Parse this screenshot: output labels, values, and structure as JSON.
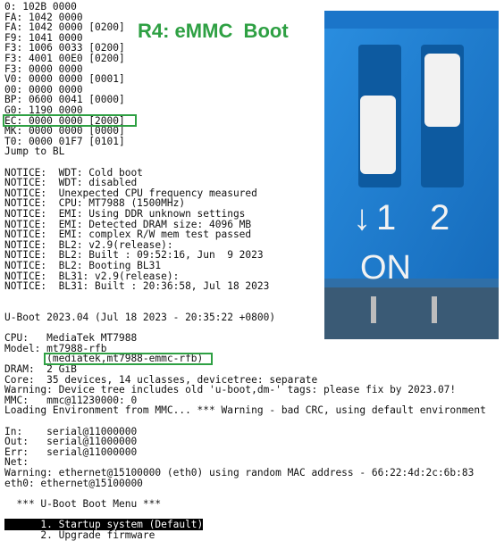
{
  "overlay": {
    "title": "R4: eMMC  Boot"
  },
  "dip_switch": {
    "on_label": "ON",
    "switch_1_label": "1",
    "switch_2_label": "2",
    "arrow_glyph": "↓"
  },
  "terminal": {
    "lines": [
      "0: 102B 0000",
      "FA: 1042 0000",
      "FA: 1042 0000 [0200]",
      "F9: 1041 0000",
      "F3: 1006 0033 [0200]",
      "F3: 4001 00E0 [0200]",
      "F3: 0000 0000",
      "V0: 0000 0000 [0001]",
      "00: 0000 0000",
      "BP: 0600 0041 [0000]",
      "G0: 1190 0000",
      "EC: 0000 0000 [2000]",
      "MK: 0000 0000 [0000]",
      "T0: 0000 01F7 [0101]",
      "Jump to BL",
      "",
      "NOTICE:  WDT: Cold boot",
      "NOTICE:  WDT: disabled",
      "NOTICE:  Unexpected CPU frequency measured",
      "NOTICE:  CPU: MT7988 (1500MHz)",
      "NOTICE:  EMI: Using DDR unknown settings",
      "NOTICE:  EMI: Detected DRAM size: 4096 MB",
      "NOTICE:  EMI: complex R/W mem test passed",
      "NOTICE:  BL2: v2.9(release):",
      "NOTICE:  BL2: Built : 09:52:16, Jun  9 2023",
      "NOTICE:  BL2: Booting BL31",
      "NOTICE:  BL31: v2.9(release):",
      "NOTICE:  BL31: Built : 20:36:58, Jul 18 2023",
      "",
      "",
      "U-Boot 2023.04 (Jul 18 2023 - 20:35:22 +0800)",
      "",
      "CPU:   MediaTek MT7988",
      "Model: mt7988-rfb",
      "       (mediatek,mt7988-emmc-rfb)",
      "DRAM:  2 GiB",
      "Core:  35 devices, 14 uclasses, devicetree: separate",
      "Warning: Device tree includes old 'u-boot,dm-' tags: please fix by 2023.07!",
      "MMC:   mmc@11230000: 0",
      "Loading Environment from MMC... *** Warning - bad CRC, using default environment",
      "",
      "In:    serial@11000000",
      "Out:   serial@11000000",
      "Err:   serial@11000000",
      "Net:",
      "Warning: ethernet@15100000 (eth0) using random MAC address - 66:22:4d:2c:6b:83",
      "eth0: ethernet@15100000",
      "",
      "  *** U-Boot Boot Menu ***",
      "",
      "      1. Startup system (Default)",
      "      2. Upgrade firmware"
    ]
  },
  "colors": {
    "highlight_green": "#2ea043",
    "switch_blue": "#1a7fd0",
    "terminal_text": "#111111"
  }
}
